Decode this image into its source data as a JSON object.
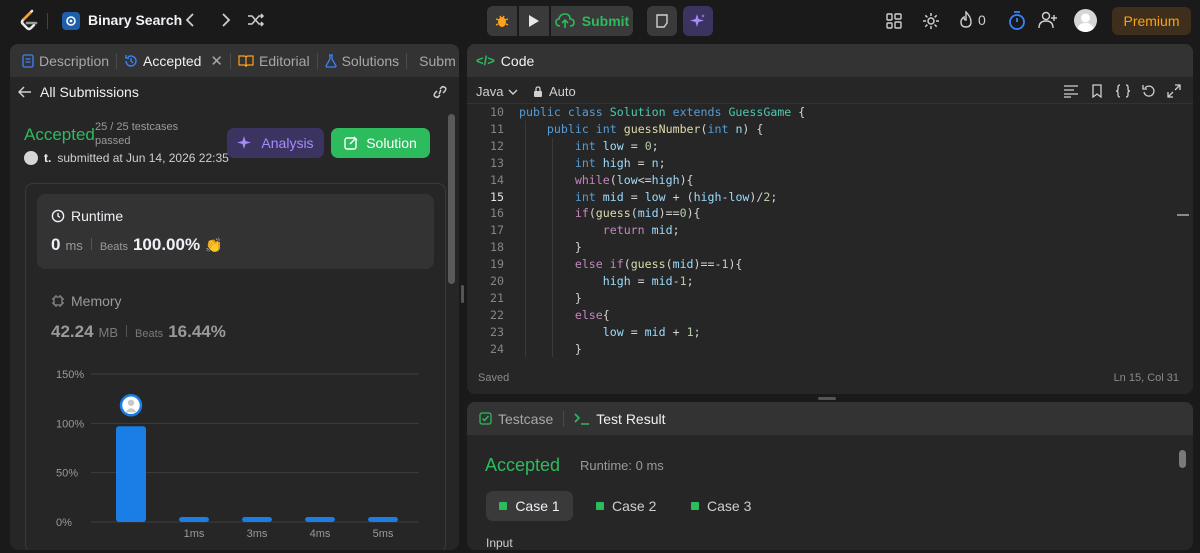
{
  "topbar": {
    "problem_title": "Binary Search",
    "submit_label": "Submit",
    "streak_count": "0",
    "premium_label": "Premium"
  },
  "left_panel": {
    "tabs": [
      {
        "label": "Description"
      },
      {
        "label": "Accepted"
      },
      {
        "label": "Editorial"
      },
      {
        "label": "Solutions"
      },
      {
        "label": "Submissions"
      }
    ],
    "back_label": "All Submissions",
    "status": "Accepted",
    "testcases": "25 / 25 testcases",
    "testcases_sub": "passed",
    "user": "t.",
    "submitted_text": "submitted at Jun 14, 2026 22:35",
    "analysis_label": "Analysis",
    "solution_label": "Solution",
    "runtime": {
      "title": "Runtime",
      "value": "0",
      "unit": "ms",
      "beats_label": "Beats",
      "beats_value": "100.00%"
    },
    "memory": {
      "title": "Memory",
      "value": "42.24",
      "unit": "MB",
      "beats_label": "Beats",
      "beats_value": "16.44%"
    }
  },
  "chart_data": {
    "type": "bar",
    "y_ticks": [
      "150%",
      "100%",
      "50%",
      "0%"
    ],
    "ylim": [
      0,
      150
    ],
    "categories": [
      "",
      "1ms",
      "3ms",
      "4ms",
      "5ms"
    ],
    "values": [
      97,
      0.5,
      0.5,
      0.5,
      0.5
    ],
    "highlight_index": 0,
    "bar_color": "#1a7ee6"
  },
  "code_panel": {
    "title": "Code",
    "language": "Java",
    "mode": "Auto",
    "lines": [
      {
        "n": "10",
        "code": "public class Solution extends GuessGame {"
      },
      {
        "n": "11",
        "code": "    public int guessNumber(int n) {"
      },
      {
        "n": "12",
        "code": "        int low = 0;"
      },
      {
        "n": "13",
        "code": "        int high = n;"
      },
      {
        "n": "14",
        "code": "        while(low<=high){"
      },
      {
        "n": "15",
        "code": "        int mid = low + (high-low)/2;"
      },
      {
        "n": "16",
        "code": "        if(guess(mid)==0){"
      },
      {
        "n": "17",
        "code": "            return mid;"
      },
      {
        "n": "18",
        "code": "        }"
      },
      {
        "n": "19",
        "code": "        else if(guess(mid)==-1){"
      },
      {
        "n": "20",
        "code": "            high = mid-1;"
      },
      {
        "n": "21",
        "code": "        }"
      },
      {
        "n": "22",
        "code": "        else{"
      },
      {
        "n": "23",
        "code": "            low = mid + 1;"
      },
      {
        "n": "24",
        "code": "        }"
      }
    ],
    "status": "Saved",
    "cursor": "Ln 15, Col 31"
  },
  "result_panel": {
    "tab_testcase": "Testcase",
    "tab_result": "Test Result",
    "status": "Accepted",
    "runtime": "Runtime: 0 ms",
    "cases": [
      "Case 1",
      "Case 2",
      "Case 3"
    ],
    "input_label": "Input"
  },
  "colors": {
    "accent_green": "#2cbb5d",
    "accent_orange": "#ffa116",
    "accent_blue": "#1a7ee6",
    "panel_bg": "#262626"
  }
}
